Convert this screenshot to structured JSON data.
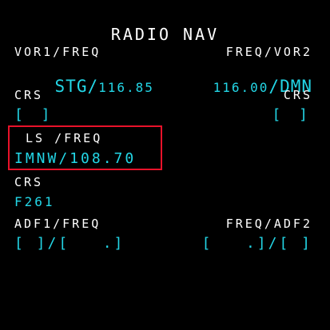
{
  "page": {
    "title": "RADIO NAV"
  },
  "vor1": {
    "label": "VOR1/FREQ",
    "ident": "STG/",
    "freq": "116.85"
  },
  "vor2": {
    "label": "FREQ/VOR2",
    "freq": "116.00",
    "ident": "/DMN"
  },
  "crs_left": {
    "label": "CRS",
    "value": "[ ]"
  },
  "crs_right": {
    "label": "CRS",
    "value": "[ ]"
  },
  "ls": {
    "label": "LS /FREQ",
    "value": "IMNW/108.70"
  },
  "ls_crs": {
    "label": "CRS",
    "value": "F261"
  },
  "adf1": {
    "label": "ADF1/FREQ",
    "value": "[ ]/[   .]"
  },
  "adf2": {
    "label": "FREQ/ADF2",
    "value": "[   .]/[ ]"
  },
  "colors": {
    "background": "#000000",
    "label": "#ffffff",
    "value": "#23d6e6",
    "highlight": "#e8122a"
  }
}
